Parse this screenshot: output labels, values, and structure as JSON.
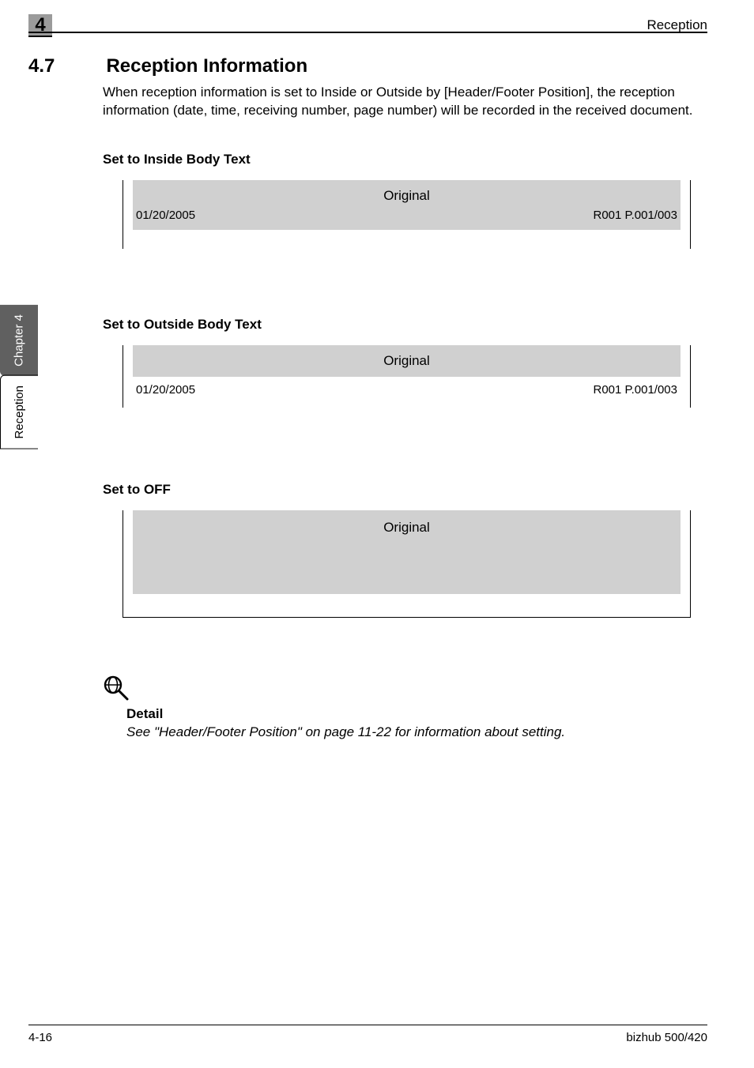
{
  "header": {
    "section_title": "Reception",
    "chapter_number": "4"
  },
  "heading": {
    "number": "4.7",
    "title": "Reception Information"
  },
  "paragraph": "When reception information is set to Inside or Outside by [Header/Footer Position], the reception information (date, time, receiving number, page number) will be recorded in the received document.",
  "subheadings": {
    "inside": "Set to Inside Body Text",
    "outside": "Set to Outside Body Text",
    "off": "Set to OFF"
  },
  "illus": {
    "inside": {
      "top_label": "Original",
      "date": "01/20/2005",
      "right": "R001 P.001/003"
    },
    "outside": {
      "top_label": "Original",
      "date": "01/20/2005",
      "right": "R001 P.001/003"
    },
    "off": {
      "top_label": "Original"
    }
  },
  "detail": {
    "heading": "Detail",
    "body": "See \"Header/Footer Position\" on page 11-22 for information about setting."
  },
  "sidetab": {
    "chapter": "Chapter 4",
    "title": "Reception"
  },
  "footer": {
    "page": "4-16",
    "model": "bizhub 500/420"
  }
}
